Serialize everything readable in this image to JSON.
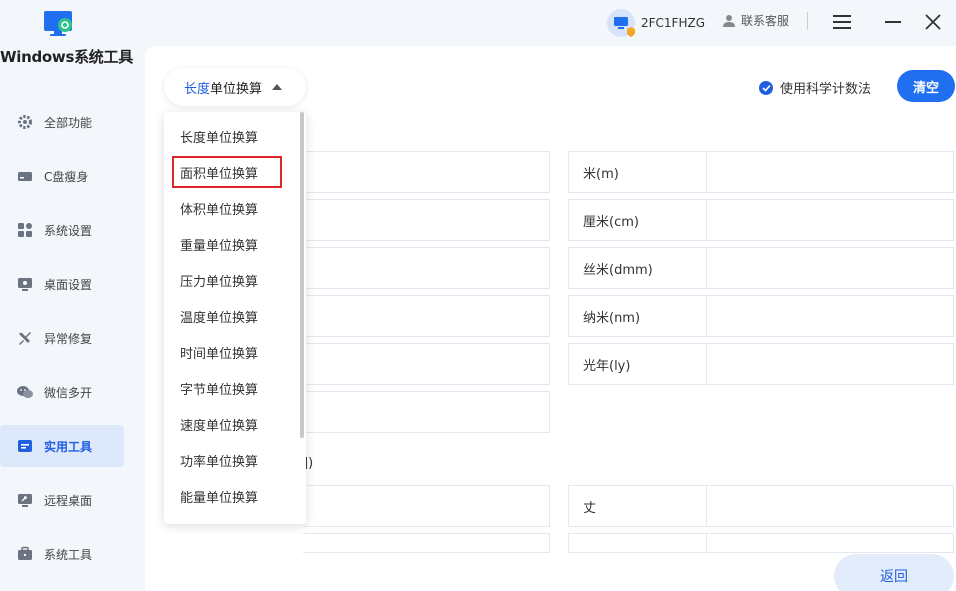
{
  "app": {
    "title": "Windows系统工具"
  },
  "sidebar": {
    "items": [
      {
        "label": "全部功能",
        "icon": "gear-icon"
      },
      {
        "label": "C盘瘦身",
        "icon": "disk-icon"
      },
      {
        "label": "系统设置",
        "icon": "grid-icon"
      },
      {
        "label": "桌面设置",
        "icon": "monitor-icon"
      },
      {
        "label": "异常修复",
        "icon": "wrench-icon"
      },
      {
        "label": "微信多开",
        "icon": "chat-icon"
      },
      {
        "label": "实用工具",
        "icon": "toolbox-icon",
        "active": true
      },
      {
        "label": "远程桌面",
        "icon": "remote-desktop-icon"
      },
      {
        "label": "系统工具",
        "icon": "briefcase-icon"
      }
    ]
  },
  "topbar": {
    "device_name": "2FC1FHZG",
    "support_label": "联系客服"
  },
  "converter": {
    "selected_prefix": "长度",
    "selected_suffix": "单位换算",
    "sci_notation_label": "使用科学计数法",
    "clear_label": "清空",
    "back_label": "返回",
    "section_tail": "])",
    "right_fields": [
      {
        "label": "米(m)",
        "value": ""
      },
      {
        "label": "厘米(cm)",
        "value": ""
      },
      {
        "label": "丝米(dmm)",
        "value": ""
      },
      {
        "label": "纳米(nm)",
        "value": ""
      },
      {
        "label": "光年(ly)",
        "value": ""
      }
    ],
    "lower_right_field": {
      "label": "丈",
      "value": ""
    }
  },
  "dropdown": {
    "options": [
      "长度单位换算",
      "面积单位换算",
      "体积单位换算",
      "重量单位换算",
      "压力单位换算",
      "温度单位换算",
      "时间单位换算",
      "字节单位换算",
      "速度单位换算",
      "功率单位换算",
      "能量单位换算"
    ],
    "highlighted_index": 1
  },
  "colors": {
    "accent": "#1f5fe0",
    "highlight_border": "#e0262b",
    "button": "#1f6ff0"
  }
}
